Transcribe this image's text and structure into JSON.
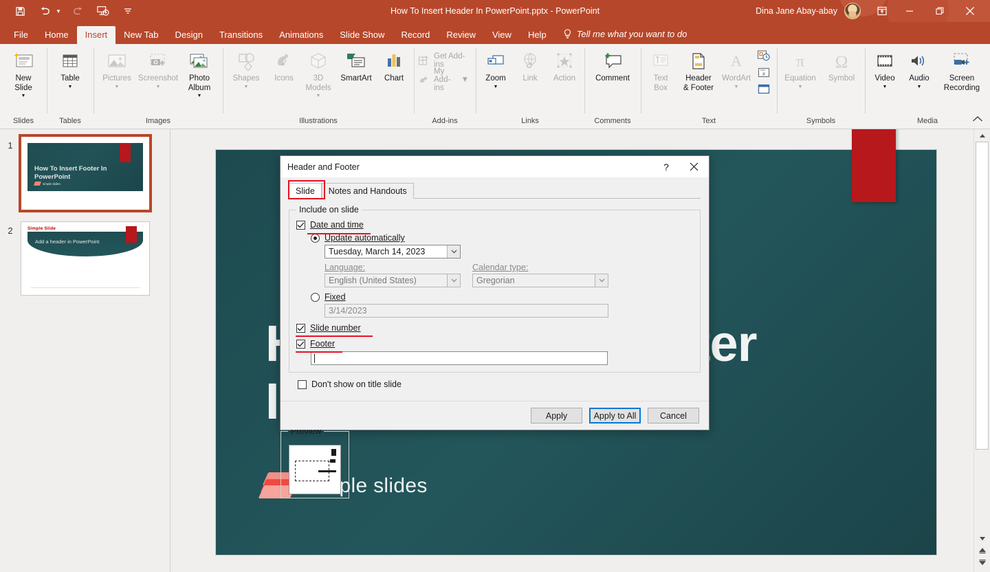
{
  "titlebar": {
    "document_title": "How To Insert Header In PowerPoint.pptx  -  PowerPoint",
    "user_name": "Dina Jane Abay-abay",
    "quick_access": [
      {
        "name": "save-icon",
        "label": "Save"
      },
      {
        "name": "undo-icon",
        "label": "Undo"
      },
      {
        "name": "redo-icon",
        "label": "Redo"
      },
      {
        "name": "start-from-beginning-icon",
        "label": "Start From Beginning"
      },
      {
        "name": "customize-quick-access-icon",
        "label": "Customize Quick Access Toolbar"
      }
    ],
    "window_controls": [
      {
        "name": "ribbon-display-options-icon",
        "label": "Ribbon Display Options"
      },
      {
        "name": "minimize-icon",
        "label": "Minimize"
      },
      {
        "name": "restore-icon",
        "label": "Restore Down"
      },
      {
        "name": "close-icon",
        "label": "Close"
      }
    ]
  },
  "tabs": {
    "items": [
      {
        "label": "File",
        "active": false
      },
      {
        "label": "Home",
        "active": false
      },
      {
        "label": "Insert",
        "active": true
      },
      {
        "label": "New Tab",
        "active": false
      },
      {
        "label": "Design",
        "active": false
      },
      {
        "label": "Transitions",
        "active": false
      },
      {
        "label": "Animations",
        "active": false
      },
      {
        "label": "Slide Show",
        "active": false
      },
      {
        "label": "Record",
        "active": false
      },
      {
        "label": "Review",
        "active": false
      },
      {
        "label": "View",
        "active": false
      },
      {
        "label": "Help",
        "active": false
      }
    ],
    "tell_me": "Tell me what you want to do"
  },
  "ribbon": {
    "groups": [
      {
        "name": "Slides",
        "items": [
          {
            "label": "New\nSlide",
            "icon": "new-slide-icon",
            "caret": true,
            "disabled": false
          }
        ]
      },
      {
        "name": "Tables",
        "items": [
          {
            "label": "Table",
            "icon": "table-icon",
            "caret": true,
            "disabled": false
          }
        ]
      },
      {
        "name": "Images",
        "items": [
          {
            "label": "Pictures",
            "icon": "pictures-icon",
            "caret": true,
            "disabled": true
          },
          {
            "label": "Screenshot",
            "icon": "screenshot-icon",
            "caret": true,
            "disabled": true
          },
          {
            "label": "Photo\nAlbum",
            "icon": "photo-album-icon",
            "caret": true,
            "disabled": false
          }
        ]
      },
      {
        "name": "Illustrations",
        "items": [
          {
            "label": "Shapes",
            "icon": "shapes-icon",
            "caret": true,
            "disabled": true
          },
          {
            "label": "Icons",
            "icon": "icons-icon",
            "caret": false,
            "disabled": true
          },
          {
            "label": "3D\nModels",
            "icon": "3d-models-icon",
            "caret": true,
            "disabled": true
          },
          {
            "label": "SmartArt",
            "icon": "smartart-icon",
            "caret": false,
            "disabled": false
          },
          {
            "label": "Chart",
            "icon": "chart-icon",
            "caret": false,
            "disabled": false
          }
        ]
      },
      {
        "name": "Add-ins",
        "items": [
          {
            "label": "Get Add-ins",
            "icon": "get-add-ins-icon",
            "disabled": true,
            "small": true
          },
          {
            "label": "My Add-ins",
            "icon": "my-add-ins-icon",
            "disabled": true,
            "small": true,
            "caret": true
          }
        ]
      },
      {
        "name": "Links",
        "items": [
          {
            "label": "Zoom",
            "icon": "zoom-icon",
            "caret": true,
            "disabled": false
          },
          {
            "label": "Link",
            "icon": "link-icon",
            "caret": false,
            "disabled": true
          },
          {
            "label": "Action",
            "icon": "action-icon",
            "caret": false,
            "disabled": true
          }
        ]
      },
      {
        "name": "Comments",
        "items": [
          {
            "label": "Comment",
            "icon": "comment-icon",
            "caret": false,
            "disabled": false
          }
        ]
      },
      {
        "name": "Text",
        "items": [
          {
            "label": "Text\nBox",
            "icon": "text-box-icon",
            "caret": false,
            "disabled": true
          },
          {
            "label": "Header\n& Footer",
            "icon": "header-footer-icon",
            "caret": false,
            "disabled": false
          },
          {
            "label": "WordArt",
            "icon": "wordart-icon",
            "caret": true,
            "disabled": true
          },
          {
            "label": "",
            "icon": "date-and-time-icon",
            "mini": true,
            "disabled": false
          },
          {
            "label": "",
            "icon": "slide-number-icon",
            "mini": true,
            "disabled": false
          },
          {
            "label": "",
            "icon": "object-icon",
            "mini": true,
            "disabled": false
          }
        ]
      },
      {
        "name": "Symbols",
        "items": [
          {
            "label": "Equation",
            "icon": "equation-icon",
            "caret": true,
            "disabled": true
          },
          {
            "label": "Symbol",
            "icon": "symbol-icon",
            "caret": false,
            "disabled": true
          }
        ]
      },
      {
        "name": "Media",
        "items": [
          {
            "label": "Video",
            "icon": "video-icon",
            "caret": true,
            "disabled": false
          },
          {
            "label": "Audio",
            "icon": "audio-icon",
            "caret": true,
            "disabled": false
          },
          {
            "label": "Screen\nRecording",
            "icon": "screen-recording-icon",
            "caret": false,
            "disabled": false
          }
        ]
      }
    ],
    "collapse_icon": "collapse-ribbon-icon"
  },
  "thumbnails": [
    {
      "number": "1",
      "selected": true,
      "title": "How To Insert Footer In PowerPoint",
      "logo_text": "simple slides"
    },
    {
      "number": "2",
      "selected": false,
      "header": "Simple Slide",
      "title": "Add a header in PowerPoint"
    }
  ],
  "slide": {
    "title": "How To Insert Footer In PowerPoint",
    "logo_text": "simple slides"
  },
  "dialog": {
    "title": "Header and Footer",
    "help_icon": "help-icon",
    "close_icon": "close-icon",
    "tabs": [
      {
        "label": "Slide",
        "active": true,
        "highlighted": true
      },
      {
        "label": "Notes and Handouts",
        "active": false,
        "highlighted": false
      }
    ],
    "group_label": "Include on slide",
    "date_and_time": {
      "label": "Date and time",
      "checked": true,
      "highlighted": true
    },
    "update_automatically": {
      "label": "Update automatically",
      "selected": true,
      "value": "Tuesday, March 14, 2023"
    },
    "language": {
      "label": "Language:",
      "value": "English (United States)",
      "disabled": true
    },
    "calendar_type": {
      "label": "Calendar type:",
      "value": "Gregorian",
      "disabled": true
    },
    "fixed": {
      "label": "Fixed",
      "selected": false,
      "value": "3/14/2023",
      "disabled": true
    },
    "slide_number": {
      "label": "Slide number",
      "checked": true,
      "highlighted": true
    },
    "footer": {
      "label": "Footer",
      "checked": true,
      "highlighted": true,
      "value": ""
    },
    "dont_show_on_title_slide": {
      "label": "Don't show on title slide",
      "checked": false
    },
    "preview_label": "Preview",
    "buttons": [
      {
        "label": "Apply",
        "focused": false
      },
      {
        "label": "Apply to All",
        "focused": true
      },
      {
        "label": "Cancel",
        "focused": false
      }
    ]
  },
  "scrollbar": {
    "up_icon": "scroll-up-icon",
    "down_icon": "scroll-down-icon",
    "previous_slide_icon": "previous-slide-icon",
    "next_slide_icon": "next-slide-icon"
  },
  "colors": {
    "brand": "#b7472a",
    "accent_red": "#b7181c",
    "annotation_red": "#e81123",
    "focus_blue": "#0078d7",
    "slide_teal": "#23565b"
  }
}
